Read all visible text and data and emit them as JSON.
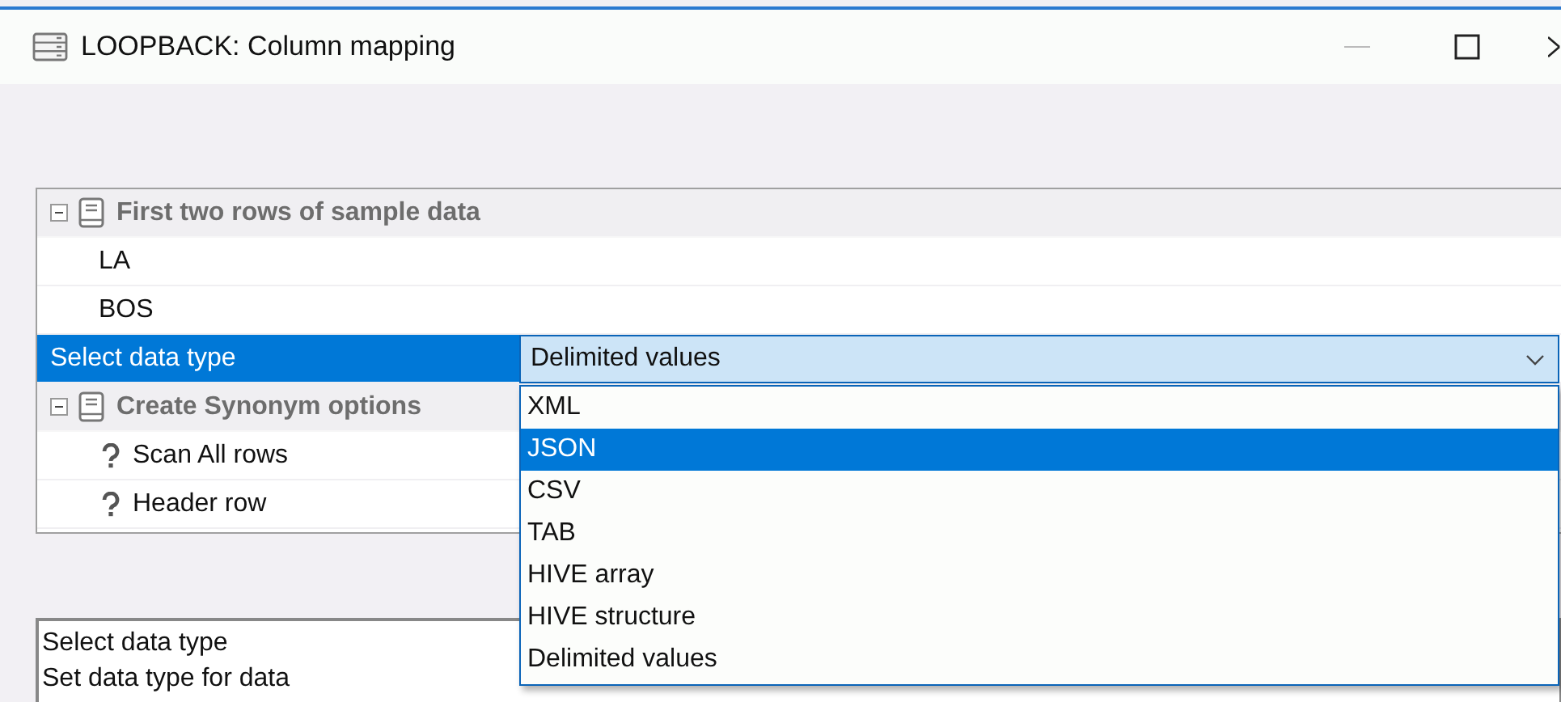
{
  "window": {
    "title": "LOOPBACK: Column mapping"
  },
  "property_grid": {
    "categories": [
      {
        "label": "First two rows of sample data",
        "expanded": true,
        "rows": [
          {
            "label": "LA",
            "kind": "sample",
            "selected": false
          },
          {
            "label": "BOS",
            "kind": "sample",
            "selected": false
          },
          {
            "label": "Select data type",
            "kind": "property",
            "selected": true,
            "value": "Delimited values"
          }
        ]
      },
      {
        "label": "Create Synonym options",
        "expanded": true,
        "rows": [
          {
            "label": "Scan All rows",
            "kind": "help",
            "selected": false
          },
          {
            "label": "Header row",
            "kind": "help",
            "selected": false
          }
        ]
      }
    ]
  },
  "dropdown": {
    "expanded": true,
    "options": [
      {
        "label": "XML",
        "selected": false
      },
      {
        "label": "JSON",
        "selected": true
      },
      {
        "label": "CSV",
        "selected": false
      },
      {
        "label": "TAB",
        "selected": false
      },
      {
        "label": "HIVE array",
        "selected": false
      },
      {
        "label": "HIVE structure",
        "selected": false
      },
      {
        "label": "Delimited values",
        "selected": false
      }
    ]
  },
  "description": {
    "title": "Select data type",
    "text": "Set data type for data"
  }
}
